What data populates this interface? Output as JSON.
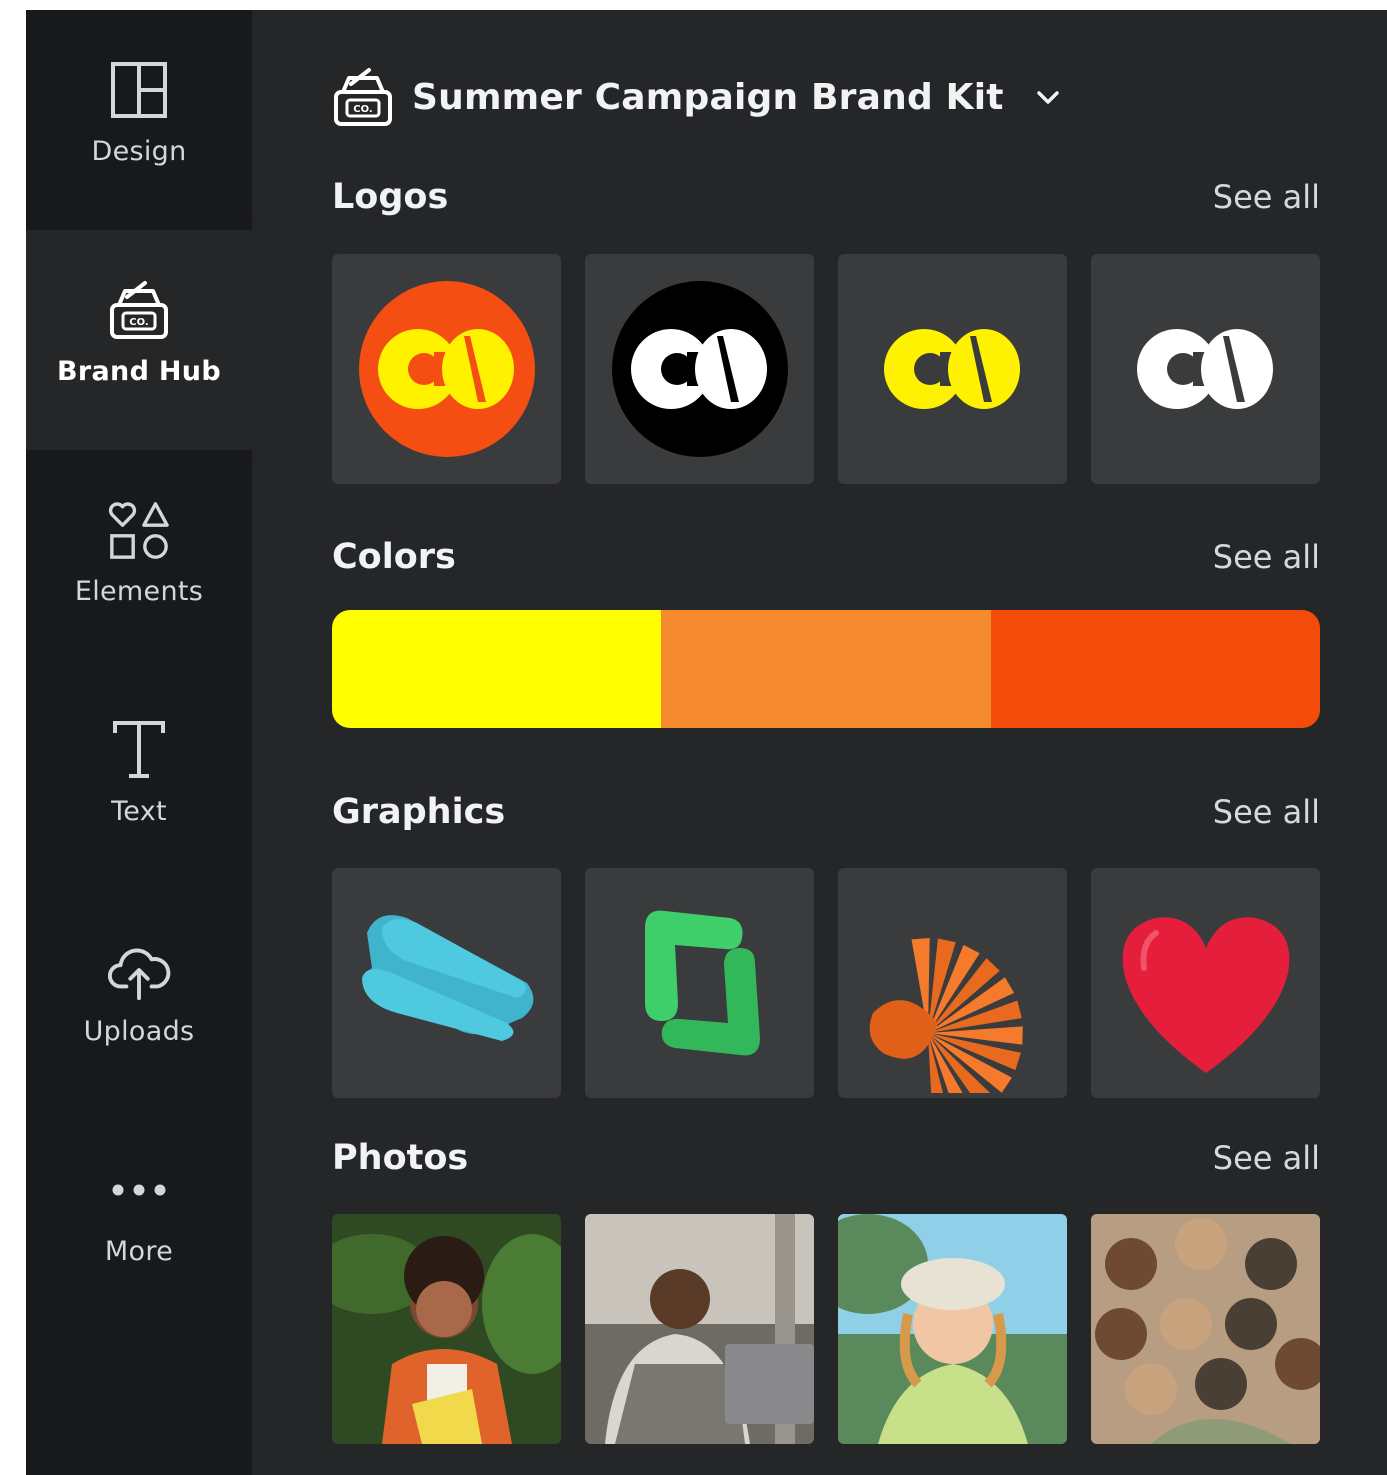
{
  "sidebar": {
    "items": [
      {
        "label": "Design",
        "icon": "layout-icon"
      },
      {
        "label": "Brand Hub",
        "icon": "brand-kit-icon"
      },
      {
        "label": "Elements",
        "icon": "shapes-icon"
      },
      {
        "label": "Text",
        "icon": "text-icon"
      },
      {
        "label": "Uploads",
        "icon": "cloud-upload-icon"
      },
      {
        "label": "More",
        "icon": "more-dots-icon"
      }
    ],
    "active": "Brand Hub"
  },
  "header": {
    "title": "Summer Campaign Brand Kit"
  },
  "sections": {
    "logos": {
      "title": "Logos",
      "see_all": "See all"
    },
    "colors": {
      "title": "Colors",
      "see_all": "See all"
    },
    "graphics": {
      "title": "Graphics",
      "see_all": "See all"
    },
    "photos": {
      "title": "Photos",
      "see_all": "See all"
    }
  },
  "logos": [
    {
      "text": "CO",
      "bg": "#f44e13",
      "fg": "#fff200"
    },
    {
      "text": "CO",
      "bg": "#000000",
      "fg": "#ffffff"
    },
    {
      "text": "CO",
      "bg": "none",
      "fg": "#fff200"
    },
    {
      "text": "CO",
      "bg": "none",
      "fg": "#ffffff"
    }
  ],
  "colors": [
    "#ffff00",
    "#f58b2e",
    "#f54b0a"
  ],
  "graphics": [
    {
      "name": "blue-3d-shape",
      "color": "#4fc9e0"
    },
    {
      "name": "green-3d-brackets",
      "color": "#3fcf6a"
    },
    {
      "name": "orange-3d-fan",
      "color": "#f57a2c"
    },
    {
      "name": "red-3d-heart",
      "color": "#e51f3b"
    }
  ],
  "photos": [
    {
      "name": "woman-orange-jacket",
      "tones": [
        "#2f4a22",
        "#e0632c",
        "#7a4a30"
      ]
    },
    {
      "name": "man-with-laptop",
      "tones": [
        "#6e6a64",
        "#c8c4bb",
        "#3b3632"
      ]
    },
    {
      "name": "woman-bucket-hat",
      "tones": [
        "#5a8a5c",
        "#e8e2d4",
        "#d69a4a"
      ]
    },
    {
      "name": "group-selfie",
      "tones": [
        "#8a7a62",
        "#b79d82",
        "#4a3f35"
      ]
    }
  ]
}
